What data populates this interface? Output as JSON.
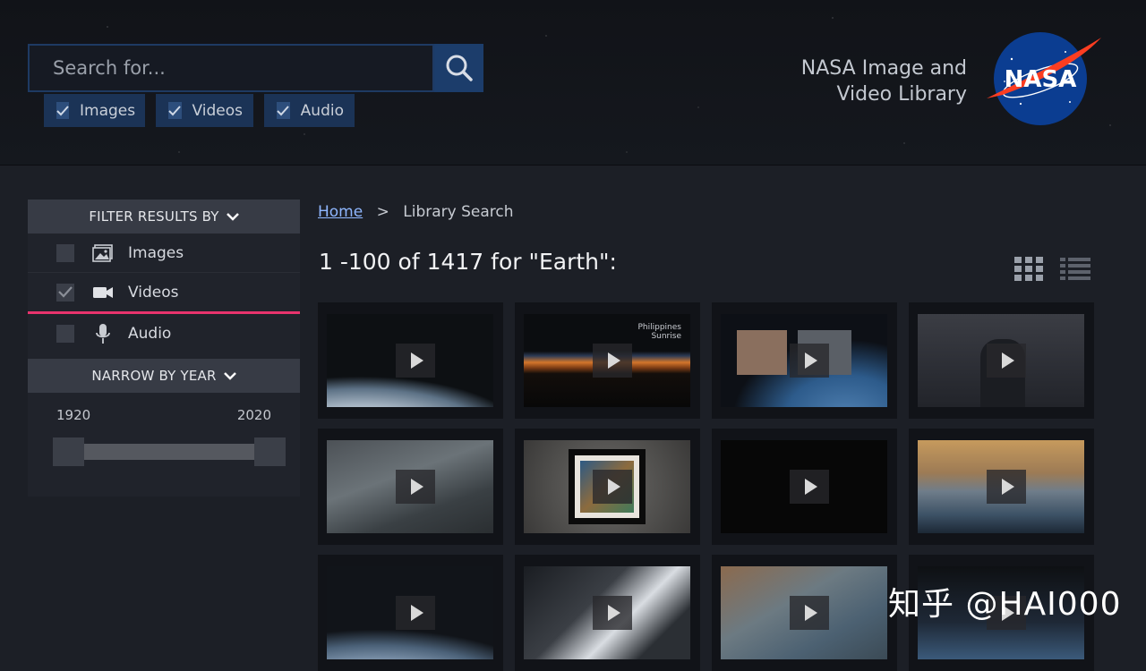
{
  "search": {
    "placeholder": "Search for..."
  },
  "type_toggles": [
    {
      "label": "Images",
      "checked": true
    },
    {
      "label": "Videos",
      "checked": true
    },
    {
      "label": "Audio",
      "checked": true
    }
  ],
  "brand": {
    "title_line1": "NASA Image and",
    "title_line2": "Video Library",
    "logo_text": "NASA"
  },
  "sidebar": {
    "filter_heading": "FILTER RESULTS BY",
    "filters": [
      {
        "label": "Images",
        "checked": false,
        "icon": "image-icon"
      },
      {
        "label": "Videos",
        "checked": true,
        "icon": "video-camera-icon"
      },
      {
        "label": "Audio",
        "checked": false,
        "icon": "microphone-icon"
      }
    ],
    "year_heading": "NARROW BY YEAR",
    "year_min": "1920",
    "year_max": "2020"
  },
  "breadcrumb": {
    "home": "Home",
    "separator": ">",
    "current": "Library Search"
  },
  "results": {
    "heading": "1 -100 of 1417 for \"Earth\":"
  },
  "view_modes": [
    "grid-view-icon",
    "list-view-icon"
  ],
  "thumbnails": [
    {
      "caption": ""
    },
    {
      "caption": "Philippines Sunrise"
    },
    {
      "caption": ""
    },
    {
      "caption": ""
    },
    {
      "caption": ""
    },
    {
      "caption": ""
    },
    {
      "caption": ""
    },
    {
      "caption": ""
    },
    {
      "caption": ""
    },
    {
      "caption": ""
    },
    {
      "caption": ""
    },
    {
      "caption": ""
    }
  ],
  "watermark": "知乎 @HAI000",
  "colors": {
    "accent": "#e8336d",
    "link": "#8fb7ff",
    "header_blue": "#1b3356"
  }
}
